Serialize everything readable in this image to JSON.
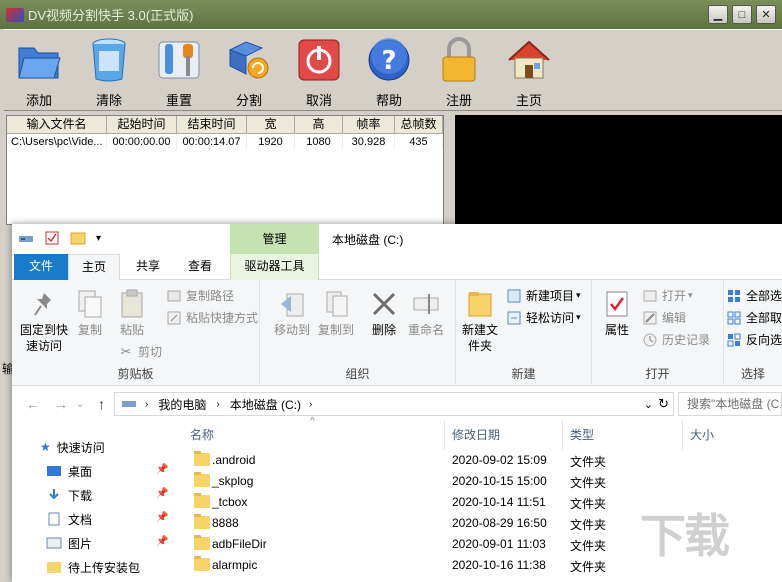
{
  "dv": {
    "title": "DV视频分割快手 3.0(正式版)",
    "toolbar": [
      {
        "label": "添加",
        "icon": "folder-icon"
      },
      {
        "label": "清除",
        "icon": "trash-icon"
      },
      {
        "label": "重置",
        "icon": "tools-icon"
      },
      {
        "label": "分割",
        "icon": "split-icon"
      },
      {
        "label": "取消",
        "icon": "power-icon"
      },
      {
        "label": "帮助",
        "icon": "help-icon"
      },
      {
        "label": "注册",
        "icon": "lock-icon"
      },
      {
        "label": "主页",
        "icon": "home-icon"
      }
    ],
    "columns": [
      "输入文件名",
      "起始时间",
      "结束时间",
      "宽",
      "高",
      "帧率",
      "总帧数"
    ],
    "rows": [
      [
        "C:\\Users\\pc\\Vide...",
        "00:00:00.00",
        "00:00:14.07",
        "1920",
        "1080",
        "30.928",
        "435"
      ]
    ],
    "side_label": "输"
  },
  "explorer": {
    "window_title": "本地磁盘 (C:)",
    "context_tab": "管理",
    "tabs": {
      "file": "文件",
      "home": "主页",
      "share": "共享",
      "view": "查看",
      "drive": "驱动器工具"
    },
    "ribbon": {
      "pin_quick_access": "固定到快速访问",
      "copy": "复制",
      "paste": "粘贴",
      "copy_path": "复制路径",
      "paste_shortcut": "粘贴快捷方式",
      "cut": "剪切",
      "clipboard_group": "剪贴板",
      "move_to": "移动到",
      "copy_to": "复制到",
      "delete": "删除",
      "rename": "重命名",
      "organize_group": "组织",
      "new_folder": "新建文件夹",
      "new_item": "新建项目",
      "easy_access": "轻松访问",
      "new_group": "新建",
      "properties": "属性",
      "open": "打开",
      "edit": "编辑",
      "history": "历史记录",
      "open_group": "打开",
      "select_all": "全部选",
      "select_none": "全部取",
      "invert": "反向选",
      "select_group": "选择"
    },
    "address": {
      "crumbs": [
        "我的电脑",
        "本地磁盘 (C:)"
      ],
      "search_placeholder": "搜索\"本地磁盘 (C:)\""
    },
    "nav": [
      {
        "label": "快速访问",
        "pinned": false
      },
      {
        "label": "桌面",
        "pinned": true
      },
      {
        "label": "下载",
        "pinned": true
      },
      {
        "label": "文档",
        "pinned": true
      },
      {
        "label": "图片",
        "pinned": true
      },
      {
        "label": "待上传安装包",
        "pinned": false
      }
    ],
    "columns": {
      "name": "名称",
      "date": "修改日期",
      "type": "类型",
      "size": "大小"
    },
    "files": [
      {
        "name": ".android",
        "date": "2020-09-02 15:09",
        "type": "文件夹"
      },
      {
        "name": "_skplog",
        "date": "2020-10-15 15:00",
        "type": "文件夹"
      },
      {
        "name": "_tcbox",
        "date": "2020-10-14 11:51",
        "type": "文件夹"
      },
      {
        "name": "8888",
        "date": "2020-08-29 16:50",
        "type": "文件夹"
      },
      {
        "name": "adbFileDir",
        "date": "2020-09-01 11:03",
        "type": "文件夹"
      },
      {
        "name": "alarmpic",
        "date": "2020-10-16 11:38",
        "type": "文件夹"
      }
    ]
  },
  "watermark": "下载"
}
